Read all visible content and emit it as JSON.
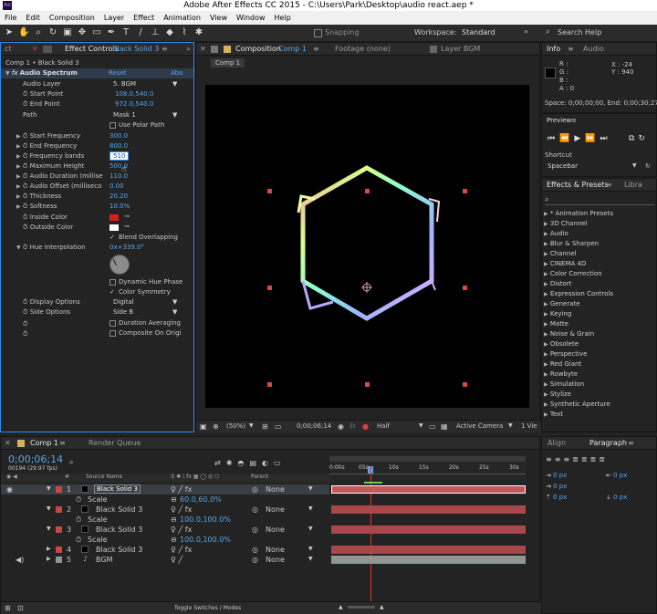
{
  "window_title": "Adobe After Effects CC 2015 - C:\\Users\\Park\\Desktop\\audio react.aep *",
  "menu": [
    "File",
    "Edit",
    "Composition",
    "Layer",
    "Effect",
    "Animation",
    "View",
    "Window",
    "Help"
  ],
  "toolbar": {
    "snapping": "Snapping",
    "workspace_label": "Workspace:",
    "workspace_value": "Standard",
    "search_help": "Search Help"
  },
  "effect_controls": {
    "tab_left": "ct",
    "tab_label": "Effect Controls",
    "tab_layer": "Black Solid 3",
    "breadcrumb": "Comp 1 • Black Solid 3",
    "effect_name": "Audio Spectrum",
    "reset": "Reset",
    "about": "Abo",
    "props": [
      {
        "label": "Audio Layer",
        "value": "5. BGM"
      },
      {
        "label": "Start Point",
        "value": "108.0,540.0"
      },
      {
        "label": "End Point",
        "value": "972.0,540.0"
      },
      {
        "label": "Path",
        "value": "Mask 1"
      },
      {
        "label": "",
        "value": "Use Polar Path"
      },
      {
        "label": "Start Frequency",
        "value": "300.0"
      },
      {
        "label": "End Frequency",
        "value": "800.0"
      },
      {
        "label": "Frequency bands",
        "value": "510"
      },
      {
        "label": "Maximum Height",
        "value": "500.0"
      },
      {
        "label": "Audio Duration (millise",
        "value": "110.0"
      },
      {
        "label": "Audio Offset (milliseco",
        "value": "0.00"
      },
      {
        "label": "Thickness",
        "value": "20.20"
      },
      {
        "label": "Softness",
        "value": "10.0%"
      },
      {
        "label": "Inside Color",
        "value": ""
      },
      {
        "label": "Outside Color",
        "value": ""
      },
      {
        "label": "",
        "value": "Blend Overlapping"
      },
      {
        "label": "Hue Interpolation",
        "value": "0x+339.0°"
      },
      {
        "label": "",
        "value": "Dynamic Hue Phase"
      },
      {
        "label": "",
        "value": "Color Symmetry"
      },
      {
        "label": "Display Options",
        "value": "Digital"
      },
      {
        "label": "Side Options",
        "value": "Side B"
      },
      {
        "label": "",
        "value": "Duration Averaging"
      },
      {
        "label": "",
        "value": "Composite On Origi"
      }
    ]
  },
  "composition": {
    "tab_label": "Composition",
    "tab_comp": "Comp 1",
    "footage_tab": "Footage (none)",
    "layer_tab": "Layer BGM",
    "comp_button": "Comp 1",
    "zoom": "(50%)",
    "timecode": "0;00;06;14",
    "resolution": "Half",
    "camera": "Active Camera",
    "views": "1 Vie"
  },
  "info": {
    "tab_info": "Info",
    "tab_audio": "Audio",
    "r": "R :",
    "g": "G :",
    "b": "B :",
    "a": "A : 0",
    "x": "X : -24",
    "y": "Y : 940",
    "duration": "Space: 0;00;00;00, End: 0;00;30;27"
  },
  "preview": {
    "title": "Preview",
    "shortcut_label": "Shortcut",
    "shortcut_value": "Spacebar"
  },
  "effects_presets": {
    "tab": "Effects & Presets",
    "tab2": "Libra",
    "items": [
      "* Animation Presets",
      "3D Channel",
      "Audio",
      "Blur & Sharpen",
      "Channel",
      "CINEMA 4D",
      "Color Correction",
      "Distort",
      "Expression Controls",
      "Generate",
      "Keying",
      "Matte",
      "Noise & Grain",
      "Obsolete",
      "Perspective",
      "Red Giant",
      "Rowbyte",
      "Simulation",
      "Stylize",
      "Synthetic Aperture",
      "Text"
    ]
  },
  "timeline": {
    "tab": "Comp 1",
    "render_queue": "Render Queue",
    "timecode": "0;00;06;14",
    "fps": "00194 (29.97 fps)",
    "col_source": "Source Name",
    "col_parent": "Parent",
    "ruler": [
      "0:00s",
      "05s",
      "10s",
      "15s",
      "20s",
      "25s",
      "30s"
    ],
    "layers": [
      {
        "num": "1",
        "name": "Black Solid 3",
        "parent": "None",
        "selected": true
      },
      {
        "num": "",
        "name": "Scale",
        "value": "60.0,60.0%",
        "sub": true
      },
      {
        "num": "2",
        "name": "Black Solid 3",
        "parent": "None"
      },
      {
        "num": "",
        "name": "Scale",
        "value": "100.0,100.0%",
        "sub": true
      },
      {
        "num": "3",
        "name": "Black Solid 3",
        "parent": "None"
      },
      {
        "num": "",
        "name": "Scale",
        "value": "100.0,100.0%",
        "sub": true
      },
      {
        "num": "4",
        "name": "Black Solid 3",
        "parent": "None"
      },
      {
        "num": "5",
        "name": "BGM",
        "parent": "None"
      }
    ],
    "toggle": "Toggle Switches / Modes"
  },
  "align_paragraph": {
    "tab_align": "Align",
    "tab_paragraph": "Paragraph",
    "fields": [
      "0 px",
      "0 px",
      "0 px",
      "0 px",
      "0 px"
    ]
  },
  "colors": {
    "accent_blue": "#5aa5e6",
    "layer_red": "#c4585a",
    "layer_bgm": "#8e9890",
    "playhead": "#e23030",
    "inside_color": "#e11a1a",
    "outside_color": "#ffffff"
  }
}
